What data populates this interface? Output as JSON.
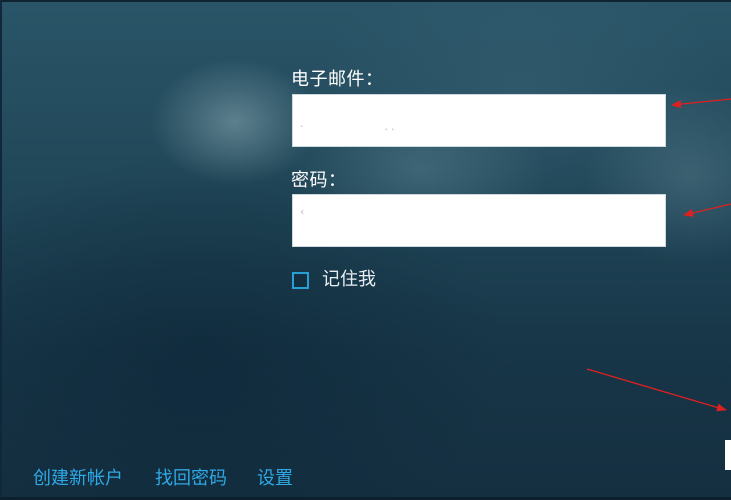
{
  "login": {
    "email_label": "电子邮件：",
    "email_value": "",
    "password_label": "密码：",
    "password_value": "",
    "remember_label": "记住我",
    "remember_checked": false
  },
  "footer": {
    "links": [
      {
        "label": "创建新帐户"
      },
      {
        "label": "找回密码"
      },
      {
        "label": "设置"
      }
    ]
  },
  "colors": {
    "accent": "#2fa8e6",
    "annotation": "#e02020"
  }
}
